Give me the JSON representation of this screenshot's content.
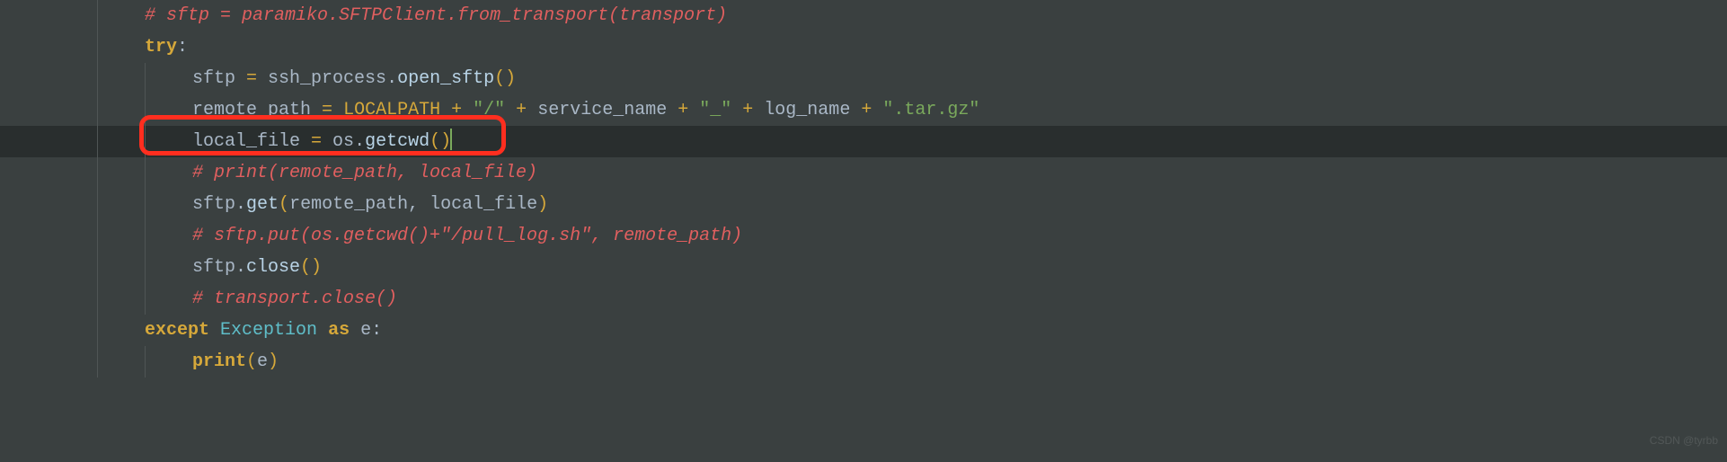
{
  "code": {
    "lines": [
      {
        "indent": 1,
        "current": false,
        "tokens": [
          {
            "cls": "comment",
            "t": "# sftp = paramiko.SFTPClient.from_transport(transport)"
          }
        ]
      },
      {
        "indent": 1,
        "current": false,
        "tokens": [
          {
            "cls": "keyword",
            "t": "try"
          },
          {
            "cls": "punct",
            "t": ":"
          }
        ]
      },
      {
        "indent": 2,
        "current": false,
        "tokens": [
          {
            "cls": "ident",
            "t": "sftp "
          },
          {
            "cls": "op",
            "t": "="
          },
          {
            "cls": "ident",
            "t": " ssh_process"
          },
          {
            "cls": "punct",
            "t": "."
          },
          {
            "cls": "call",
            "t": "open_sftp"
          },
          {
            "cls": "paren",
            "t": "()"
          }
        ]
      },
      {
        "indent": 2,
        "current": false,
        "tokens": [
          {
            "cls": "ident",
            "t": "remote_path "
          },
          {
            "cls": "op",
            "t": "="
          },
          {
            "cls": "ident",
            "t": " "
          },
          {
            "cls": "const",
            "t": "LOCALPATH"
          },
          {
            "cls": "ident",
            "t": " "
          },
          {
            "cls": "op",
            "t": "+"
          },
          {
            "cls": "ident",
            "t": " "
          },
          {
            "cls": "string",
            "t": "\"/\""
          },
          {
            "cls": "ident",
            "t": " "
          },
          {
            "cls": "op",
            "t": "+"
          },
          {
            "cls": "ident",
            "t": " service_name "
          },
          {
            "cls": "op",
            "t": "+"
          },
          {
            "cls": "ident",
            "t": " "
          },
          {
            "cls": "string",
            "t": "\"_\""
          },
          {
            "cls": "ident",
            "t": " "
          },
          {
            "cls": "op",
            "t": "+"
          },
          {
            "cls": "ident",
            "t": " log_name "
          },
          {
            "cls": "op",
            "t": "+"
          },
          {
            "cls": "ident",
            "t": " "
          },
          {
            "cls": "string",
            "t": "\".tar.gz\""
          }
        ]
      },
      {
        "indent": 2,
        "current": true,
        "tokens": [
          {
            "cls": "ident",
            "t": "local_file "
          },
          {
            "cls": "op",
            "t": "="
          },
          {
            "cls": "ident",
            "t": " os"
          },
          {
            "cls": "punct",
            "t": "."
          },
          {
            "cls": "call",
            "t": "getcwd"
          },
          {
            "cls": "paren",
            "t": "()"
          }
        ],
        "cursor": true
      },
      {
        "indent": 2,
        "current": false,
        "tokens": [
          {
            "cls": "comment",
            "t": "# print(remote_path, local_file)"
          }
        ]
      },
      {
        "indent": 2,
        "current": false,
        "tokens": [
          {
            "cls": "ident",
            "t": "sftp"
          },
          {
            "cls": "punct",
            "t": "."
          },
          {
            "cls": "call",
            "t": "get"
          },
          {
            "cls": "paren",
            "t": "("
          },
          {
            "cls": "ident",
            "t": "remote_path"
          },
          {
            "cls": "punct",
            "t": ", "
          },
          {
            "cls": "ident",
            "t": "local_file"
          },
          {
            "cls": "paren",
            "t": ")"
          }
        ]
      },
      {
        "indent": 2,
        "current": false,
        "tokens": [
          {
            "cls": "comment",
            "t": "# sftp.put(os.getcwd()+\"/pull_log.sh\", remote_path)"
          }
        ]
      },
      {
        "indent": 2,
        "current": false,
        "tokens": [
          {
            "cls": "ident",
            "t": "sftp"
          },
          {
            "cls": "punct",
            "t": "."
          },
          {
            "cls": "call",
            "t": "close"
          },
          {
            "cls": "paren",
            "t": "()"
          }
        ]
      },
      {
        "indent": 2,
        "current": false,
        "tokens": [
          {
            "cls": "comment",
            "t": "# transport.close()"
          }
        ]
      },
      {
        "indent": 1,
        "current": false,
        "tokens": [
          {
            "cls": "keyword",
            "t": "except"
          },
          {
            "cls": "ident",
            "t": " "
          },
          {
            "cls": "builtin",
            "t": "Exception"
          },
          {
            "cls": "ident",
            "t": " "
          },
          {
            "cls": "keyword",
            "t": "as"
          },
          {
            "cls": "ident",
            "t": " e"
          },
          {
            "cls": "punct",
            "t": ":"
          }
        ]
      },
      {
        "indent": 2,
        "current": false,
        "tokens": [
          {
            "cls": "keyword",
            "t": "print"
          },
          {
            "cls": "paren",
            "t": "("
          },
          {
            "cls": "ident",
            "t": "e"
          },
          {
            "cls": "paren",
            "t": ")"
          }
        ]
      }
    ]
  },
  "watermark": "CSDN @tyrbb"
}
